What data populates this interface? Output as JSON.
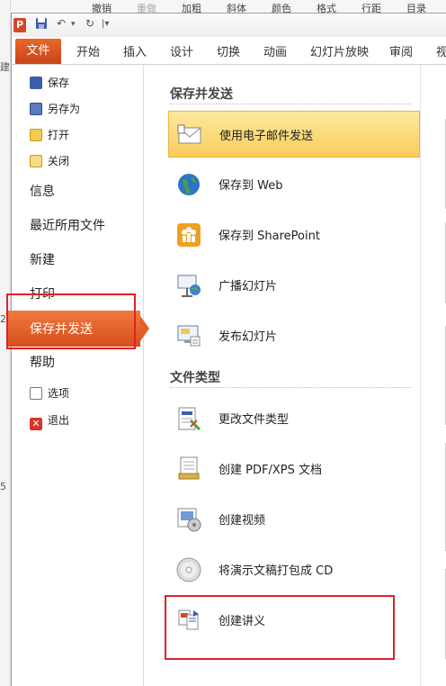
{
  "background_toolbar": {
    "items": [
      "撤销",
      "重做",
      "加粗",
      "斜体",
      "颜色",
      "格式",
      "行距",
      "目录"
    ],
    "left_fragments": [
      "建",
      "2",
      "5"
    ]
  },
  "qat": {
    "app_icon": "P",
    "save_icon": "save-icon",
    "undo_icon": "undo-icon",
    "redo_icon": "redo-icon",
    "customize_icon": "customize-qat-icon"
  },
  "ribbon": {
    "file_tab": "文件",
    "tabs": [
      "开始",
      "插入",
      "设计",
      "切换",
      "动画",
      "幻灯片放映",
      "审阅",
      "视"
    ]
  },
  "nav": {
    "small_items_top": [
      {
        "label": "保存",
        "icon": "save-icon"
      },
      {
        "label": "另存为",
        "icon": "save-as-icon"
      },
      {
        "label": "打开",
        "icon": "open-folder-icon"
      },
      {
        "label": "关闭",
        "icon": "close-folder-icon"
      }
    ],
    "big_items": [
      "信息",
      "最近所用文件",
      "新建",
      "打印",
      "保存并发送",
      "帮助"
    ],
    "active": "保存并发送",
    "small_items_bottom": [
      {
        "label": "选项",
        "icon": "options-icon"
      },
      {
        "label": "退出",
        "icon": "exit-icon"
      }
    ]
  },
  "main": {
    "section_send": "保存并发送",
    "send_items": [
      {
        "label": "使用电子邮件发送",
        "icon": "email-icon",
        "selected": true
      },
      {
        "label": "保存到 Web",
        "icon": "globe-icon",
        "selected": false
      },
      {
        "label": "保存到 SharePoint",
        "icon": "sharepoint-icon",
        "selected": false
      },
      {
        "label": "广播幻灯片",
        "icon": "broadcast-icon",
        "selected": false
      },
      {
        "label": "发布幻灯片",
        "icon": "publish-slides-icon",
        "selected": false
      }
    ],
    "section_filetypes": "文件类型",
    "filetype_items": [
      {
        "label": "更改文件类型",
        "icon": "change-file-type-icon"
      },
      {
        "label": "创建 PDF/XPS 文档",
        "icon": "pdf-document-icon"
      },
      {
        "label": "创建视频",
        "icon": "video-icon"
      },
      {
        "label": "将演示文稿打包成 CD",
        "icon": "cd-icon"
      },
      {
        "label": "创建讲义",
        "icon": "handouts-icon"
      }
    ]
  },
  "colors": {
    "accent_orange": "#d24726",
    "selection_yellow": "#f9cd5a",
    "annotation_red": "#e0202a"
  }
}
